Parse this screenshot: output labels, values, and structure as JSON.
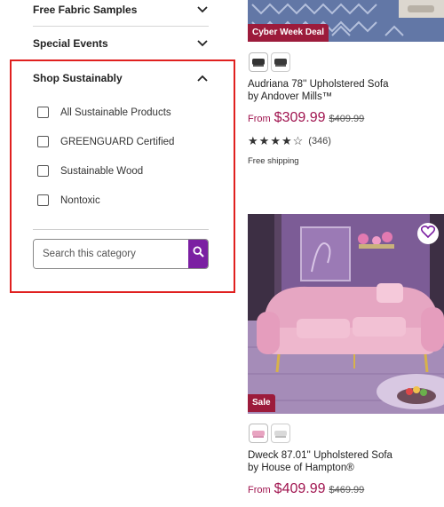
{
  "filters": {
    "collapsed": [
      {
        "label": "Free Fabric Samples"
      },
      {
        "label": "Special Events"
      }
    ],
    "section": {
      "title": "Shop Sustainably",
      "options": [
        {
          "label": "All Sustainable Products"
        },
        {
          "label": "GREENGUARD Certified"
        },
        {
          "label": "Sustainable Wood"
        },
        {
          "label": "Nontoxic"
        }
      ],
      "search_placeholder": "Search this category"
    }
  },
  "colors": {
    "highlight_border": "#e0201f",
    "brand_purple": "#7b1fa2",
    "price": "#a0144f",
    "badge_deal": "#9c1b3b",
    "badge_sale": "#9c1b3b"
  },
  "products": [
    {
      "badge": "Cyber Week Deal",
      "title_line1": "Audriana 78'' Upholstered Sofa",
      "title_line2": "by Andover Mills™",
      "price_prefix": "From",
      "price": "$309.99",
      "was_price": "$409.99",
      "rating_stars": 4,
      "rating_count": "(346)",
      "shipping": "Free shipping"
    },
    {
      "badge": "Sale",
      "title_line1": "Dweck 87.01'' Upholstered Sofa",
      "title_line2": "by House of Hampton®",
      "price_prefix": "From",
      "price": "$409.99",
      "was_price": "$469.99"
    }
  ],
  "icons": {
    "chevron_down": "chevron-down-icon",
    "chevron_up": "chevron-up-icon",
    "search": "search-icon",
    "heart": "heart-icon"
  }
}
